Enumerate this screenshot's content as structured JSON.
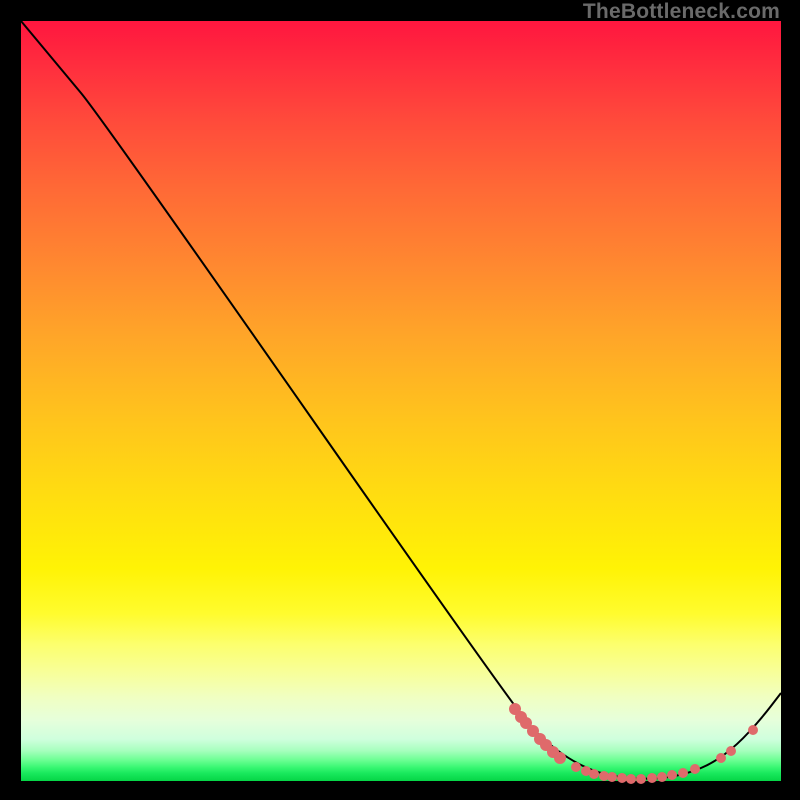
{
  "watermark": "TheBottleneck.com",
  "colors": {
    "curve_stroke": "#000000",
    "marker_fill": "#df6a6b",
    "background_page": "#000000"
  },
  "chart_data": {
    "type": "line",
    "title": "",
    "xlabel": "",
    "ylabel": "",
    "xlim": [
      0,
      760
    ],
    "ylim_percent": [
      0,
      100
    ],
    "curve_points": [
      {
        "x": 0,
        "y": 0
      },
      {
        "x": 40,
        "y": 48
      },
      {
        "x": 80,
        "y": 96
      },
      {
        "x": 498,
        "y": 694
      },
      {
        "x": 524,
        "y": 720
      },
      {
        "x": 548,
        "y": 738
      },
      {
        "x": 572,
        "y": 750
      },
      {
        "x": 596,
        "y": 756
      },
      {
        "x": 620,
        "y": 758
      },
      {
        "x": 644,
        "y": 757
      },
      {
        "x": 668,
        "y": 752
      },
      {
        "x": 692,
        "y": 742
      },
      {
        "x": 716,
        "y": 724
      },
      {
        "x": 740,
        "y": 698
      },
      {
        "x": 760,
        "y": 672
      }
    ],
    "markers": [
      {
        "x": 494,
        "y": 688,
        "r": 6
      },
      {
        "x": 500,
        "y": 696,
        "r": 6
      },
      {
        "x": 505,
        "y": 702,
        "r": 6
      },
      {
        "x": 512,
        "y": 710,
        "r": 6
      },
      {
        "x": 519,
        "y": 718,
        "r": 6
      },
      {
        "x": 525,
        "y": 724,
        "r": 6
      },
      {
        "x": 532,
        "y": 731,
        "r": 6
      },
      {
        "x": 539,
        "y": 737,
        "r": 6
      },
      {
        "x": 555,
        "y": 746,
        "r": 5
      },
      {
        "x": 565,
        "y": 750,
        "r": 5
      },
      {
        "x": 573,
        "y": 753,
        "r": 5
      },
      {
        "x": 583,
        "y": 755,
        "r": 5
      },
      {
        "x": 591,
        "y": 756,
        "r": 5
      },
      {
        "x": 601,
        "y": 757,
        "r": 5
      },
      {
        "x": 610,
        "y": 758,
        "r": 5
      },
      {
        "x": 620,
        "y": 758,
        "r": 5
      },
      {
        "x": 631,
        "y": 757,
        "r": 5
      },
      {
        "x": 641,
        "y": 756,
        "r": 5
      },
      {
        "x": 651,
        "y": 754,
        "r": 5
      },
      {
        "x": 662,
        "y": 752,
        "r": 5
      },
      {
        "x": 674,
        "y": 748,
        "r": 5
      },
      {
        "x": 700,
        "y": 737,
        "r": 5
      },
      {
        "x": 710,
        "y": 730,
        "r": 5
      },
      {
        "x": 732,
        "y": 709,
        "r": 5
      }
    ]
  }
}
